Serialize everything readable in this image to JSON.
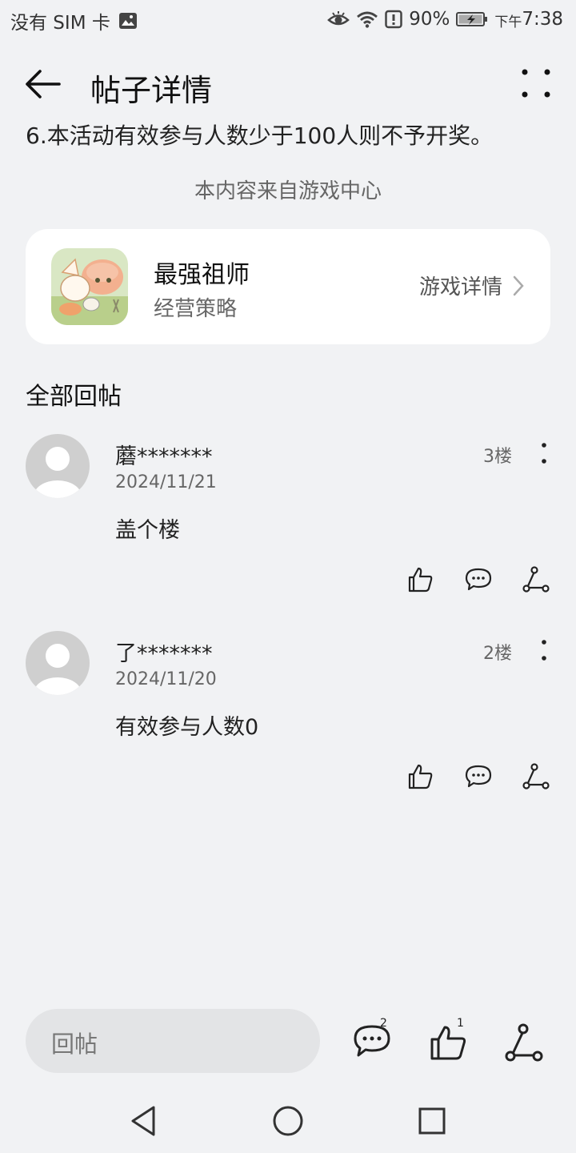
{
  "status_bar": {
    "carrier": "没有 SIM 卡",
    "battery": "90%",
    "ampm": "下午",
    "time": "7:38"
  },
  "header": {
    "title": "帖子详情"
  },
  "post": {
    "last_line": "6.本活动有效参与人数少于100人则不予开奖。",
    "source_note": "本内容来自游戏中心"
  },
  "game_card": {
    "name": "最强祖师",
    "genre": "经营策略",
    "detail_link": "游戏详情"
  },
  "replies_section": {
    "title": "全部回帖",
    "replies": [
      {
        "user": "蘑*******",
        "date": "2024/11/21",
        "floor": "3楼",
        "content": "盖个楼"
      },
      {
        "user": "了*******",
        "date": "2024/11/20",
        "floor": "2楼",
        "content": "有效参与人数0"
      }
    ]
  },
  "bottom_bar": {
    "reply_placeholder": "回帖",
    "comment_count": "2",
    "like_count": "1"
  },
  "colors": {
    "background": "#f1f2f4",
    "card": "#ffffff",
    "input": "#e3e4e6"
  }
}
